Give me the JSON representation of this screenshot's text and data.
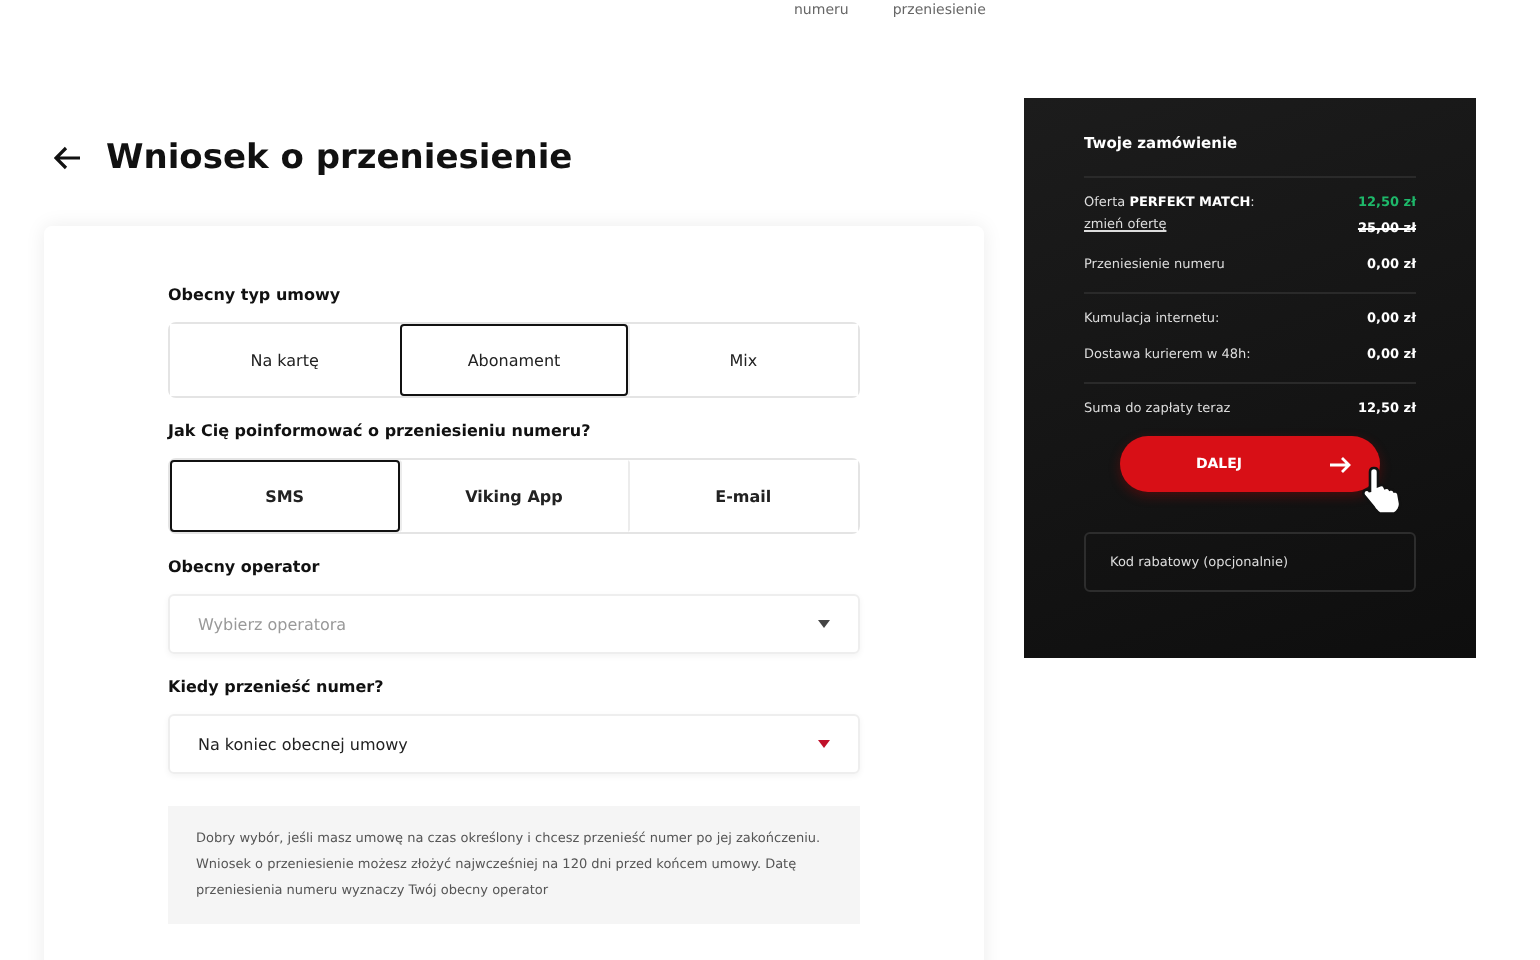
{
  "steps": [
    "numeru",
    "przeniesienie"
  ],
  "title": "Wniosek o przeniesienie",
  "contract_type": {
    "label": "Obecny typ umowy",
    "options": [
      {
        "label": "Na kartę",
        "selected": false
      },
      {
        "label": "Abonament",
        "selected": true
      },
      {
        "label": "Mix",
        "selected": false
      }
    ]
  },
  "notify": {
    "label": "Jak Cię poinformować o przeniesieniu numeru?",
    "options": [
      {
        "label": "SMS",
        "selected": true
      },
      {
        "label": "Viking App",
        "selected": false
      },
      {
        "label": "E-mail",
        "selected": false
      }
    ]
  },
  "operator": {
    "label": "Obecny operator",
    "placeholder": "Wybierz operatora"
  },
  "when": {
    "label": "Kiedy przenieść numer?",
    "value": "Na koniec obecnej umowy"
  },
  "info": "Dobry wybór, jeśli masz umowę na czas określony i chcesz przenieść numer po jej zakończeniu. Wniosek o przeniesienie możesz złożyć najwcześniej na 120 dni przed końcem umowy. Datę przeniesienia numeru wyznaczy Twój obecny operator",
  "order": {
    "title": "Twoje zamówienie",
    "offer": "Oferta **PERFEKT MATCH**:",
    "change_link": "zmień ofertę",
    "new_price": "12,50 zł",
    "old_price": "25,00 zł",
    "rows": [
      {
        "label": "Przeniesienie numeru",
        "value": "0,00 zł"
      },
      {
        "label": "Kumulacja internetu:",
        "value": "0,00 zł"
      },
      {
        "label": "Dostawa kurierem w 48h:",
        "value": "0,00 zł"
      },
      {
        "label": "Suma do zapłaty teraz",
        "value": "12,50 zł"
      }
    ],
    "button": "DALEJ",
    "coupon_placeholder": "Kod rabatowy (opcjonalnie)"
  }
}
